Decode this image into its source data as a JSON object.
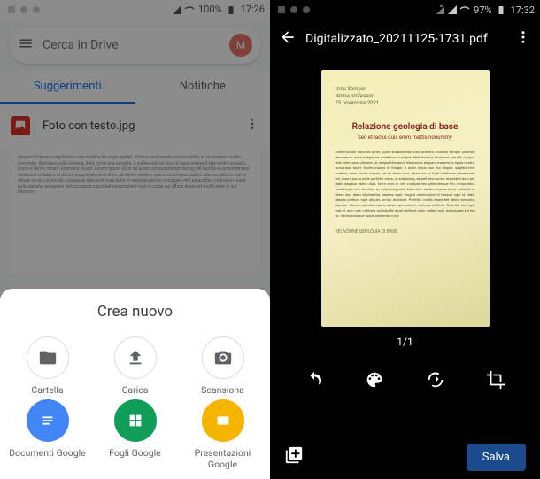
{
  "left": {
    "status": {
      "battery": "100%",
      "time": "17:26"
    },
    "search_placeholder": "Cerca in Drive",
    "avatar_initial": "M",
    "tabs": {
      "suggestions": "Suggerimenti",
      "notifications": "Notifiche"
    },
    "file": {
      "name": "Foto con testo.jpg"
    },
    "sheet": {
      "title": "Crea nuovo",
      "items": {
        "folder": "Cartella",
        "upload": "Carica",
        "scan": "Scansiona",
        "docs": "Documenti Google",
        "sheets": "Fogli Google",
        "slides": "Presentazioni Google"
      }
    }
  },
  "right": {
    "status": {
      "battery": "97%",
      "time": "17:32"
    },
    "title": "Digitalizzato_20211125-1731.pdf",
    "page_counter": "1/1",
    "page": {
      "author": "Urna Semper",
      "role": "Nome professor",
      "date": "25 novembre 2021",
      "title": "Relazione geologia di base",
      "subtitle": "Sed et lacus quis enim mattis nonummy",
      "footer": "RELAZIONE GEOLOGIA DI BASE"
    },
    "save_label": "Salva"
  }
}
